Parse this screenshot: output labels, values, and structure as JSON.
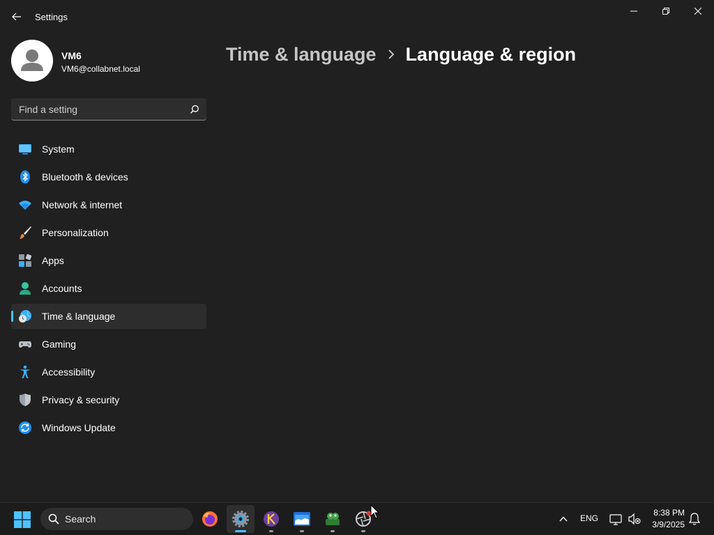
{
  "window": {
    "app_title": "Settings"
  },
  "profile": {
    "name": "VM6",
    "email": "VM6@collabnet.local"
  },
  "search": {
    "placeholder": "Find a setting",
    "value": ""
  },
  "nav": {
    "items": [
      {
        "label": "System",
        "icon": "system-icon"
      },
      {
        "label": "Bluetooth & devices",
        "icon": "bluetooth-icon"
      },
      {
        "label": "Network & internet",
        "icon": "wifi-icon"
      },
      {
        "label": "Personalization",
        "icon": "brush-icon"
      },
      {
        "label": "Apps",
        "icon": "apps-icon"
      },
      {
        "label": "Accounts",
        "icon": "person-icon"
      },
      {
        "label": "Time & language",
        "icon": "globe-clock-icon",
        "selected": true
      },
      {
        "label": "Gaming",
        "icon": "controller-icon"
      },
      {
        "label": "Accessibility",
        "icon": "accessibility-icon"
      },
      {
        "label": "Privacy & security",
        "icon": "shield-icon"
      },
      {
        "label": "Windows Update",
        "icon": "update-icon"
      }
    ]
  },
  "breadcrumb": {
    "parent": "Time & language",
    "current": "Language & region"
  },
  "taskbar": {
    "search_label": "Search",
    "apps": [
      {
        "name": "firefox-icon",
        "active": false,
        "running": false
      },
      {
        "name": "settings-gear-icon",
        "active": true,
        "running": true
      },
      {
        "name": "app-k-icon",
        "active": false,
        "running": true
      },
      {
        "name": "app-blue-window-icon",
        "active": false,
        "running": true
      },
      {
        "name": "app-green-frog-icon",
        "active": false,
        "running": true
      },
      {
        "name": "app-aperture-icon",
        "active": false,
        "running": true
      }
    ],
    "tray": {
      "language": "ENG",
      "time": "8:38 PM",
      "date": "3/9/2025"
    }
  },
  "colors": {
    "background": "#202020",
    "accent": "#4cc2ff",
    "selected_item": "#2d2d2d",
    "taskbar": "#1c1c1c"
  }
}
